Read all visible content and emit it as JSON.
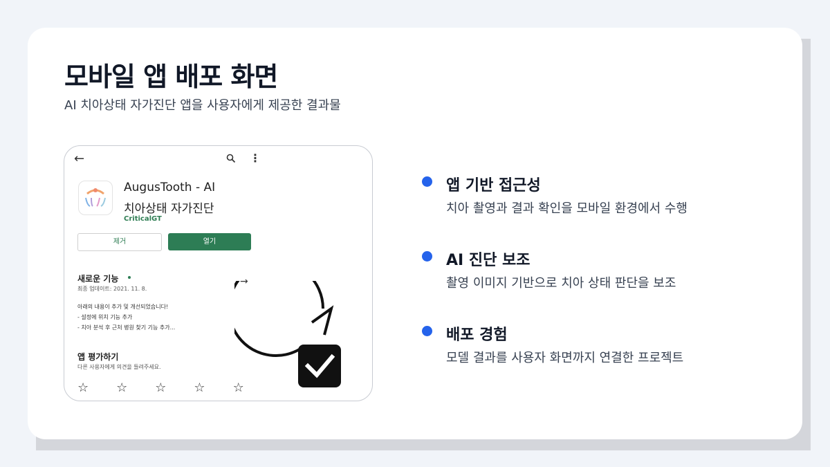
{
  "page": {
    "title": "모바일 앱 배포 화면",
    "subtitle": "AI 치아상태 자가진단 앱을 사용자에게 제공한 결과물"
  },
  "phone": {
    "app_name": "AugusTooth - AI",
    "app_subname": "치아상태 자가진단",
    "developer": "CriticalGT",
    "uninstall_label": "제거",
    "open_label": "열기",
    "whats_new_title": "새로운 기능",
    "update_date": "최종 업데이트: 2021. 11. 8.",
    "notes": [
      "아래의 내용이 추가 및 개선되었습니다!",
      "- 설정에 위치 기능 추가",
      "- 치아 분석 후 근처 병원 찾기 기능 추가..."
    ],
    "rate_title": "앱 평가하기",
    "rate_desc": "다른 사용자에게 의견을 들려주세요.",
    "star_count": 5,
    "icons": [
      "back-arrow-icon",
      "search-icon",
      "more-vert-icon",
      "arrow-right-icon",
      "refresh-icon",
      "checkbox-checked-icon",
      "star-outline-icon"
    ]
  },
  "features": [
    {
      "title": "앱 기반 접근성",
      "desc": "치아 촬영과 결과 확인을 모바일 환경에서 수행"
    },
    {
      "title": "AI 진단 보조",
      "desc": "촬영 이미지 기반으로 치아 상태 판단을 보조"
    },
    {
      "title": "배포 경험",
      "desc": "모델 결과를 사용자 화면까지 연결한 프로젝트"
    }
  ],
  "colors": {
    "accent": "#2563eb",
    "play_green": "#2d7d55",
    "background": "#f1f4f9",
    "card": "#ffffff"
  }
}
